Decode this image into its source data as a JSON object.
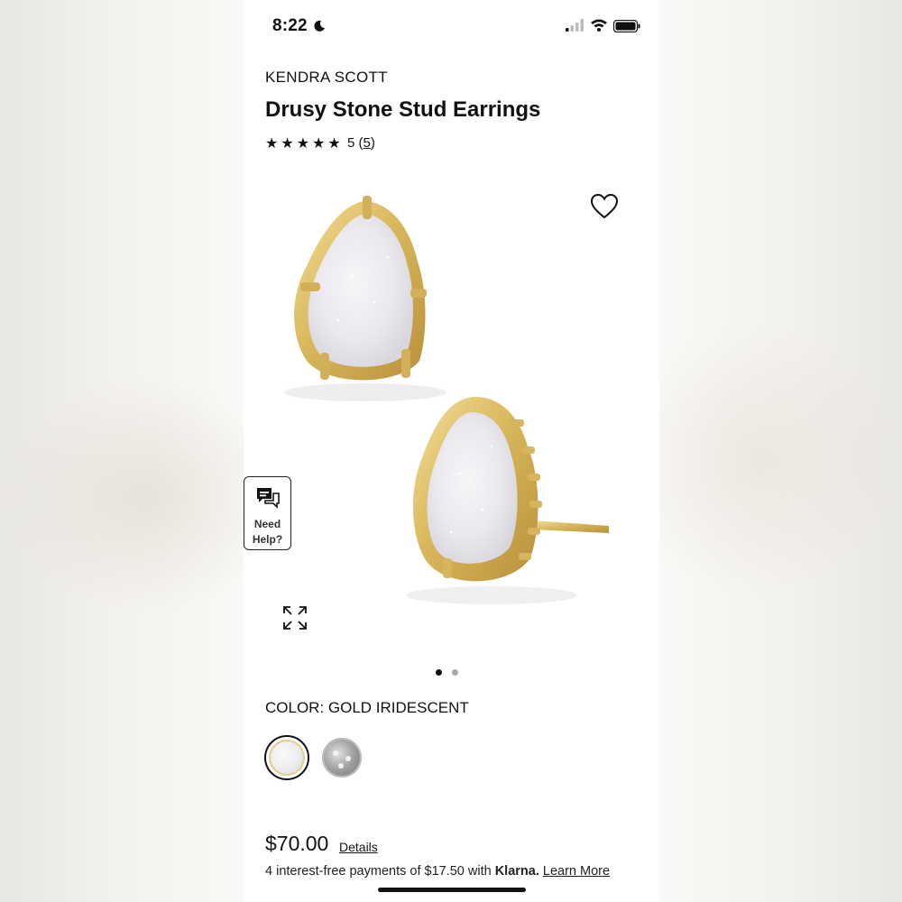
{
  "status_bar": {
    "time": "8:22",
    "icons": [
      "moon-icon",
      "signal-icon",
      "wifi-icon",
      "battery-icon"
    ]
  },
  "product": {
    "brand": "KENDRA SCOTT",
    "title": "Drusy Stone Stud Earrings",
    "stars": "★★★★★",
    "rating_value": "5",
    "rating_count": "5",
    "image_description": "Gold drusy stone stud earrings"
  },
  "help_widget": {
    "line1": "Need",
    "line2": "Help?"
  },
  "carousel": {
    "total_slides": 2,
    "active_index": 0
  },
  "color": {
    "label": "COLOR: GOLD IRIDESCENT",
    "swatches": [
      {
        "name": "gold-iridescent",
        "selected": true
      },
      {
        "name": "silver-drusy",
        "selected": false
      }
    ]
  },
  "pricing": {
    "price": "$70.00",
    "details_link": "Details",
    "installments_prefix": "4 interest-free payments of $17.50 with ",
    "klarna": "Klarna.",
    "learn_more": "Learn More"
  },
  "colors": {
    "text": "#111111",
    "gold": "#d8b65a",
    "stone": "#eeecee"
  }
}
